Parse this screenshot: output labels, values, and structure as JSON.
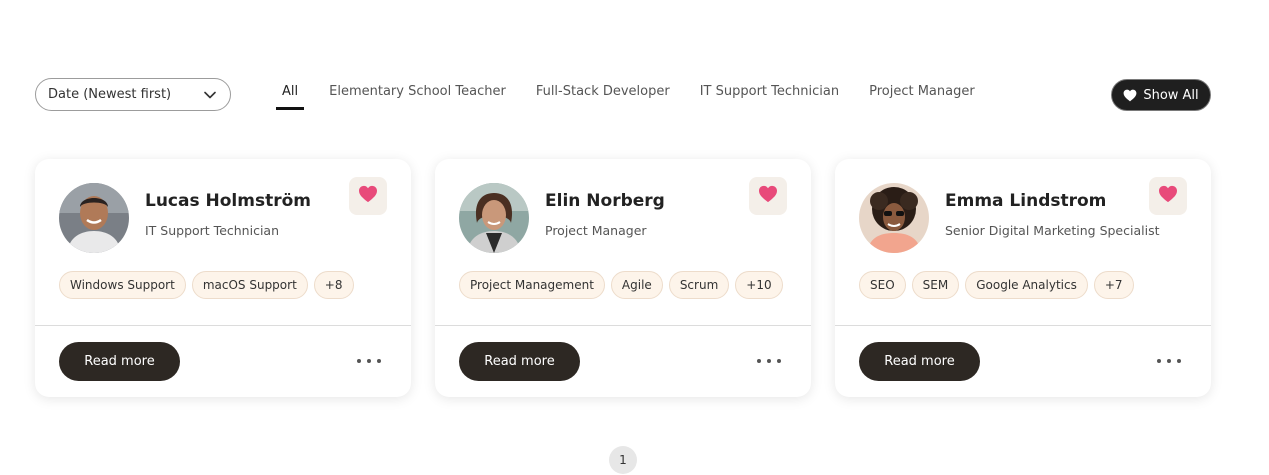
{
  "filters": {
    "sort_value": "Date (Newest first)",
    "tabs": [
      {
        "label": "All",
        "active": true
      },
      {
        "label": "Elementary School Teacher",
        "active": false
      },
      {
        "label": "Full-Stack Developer",
        "active": false
      },
      {
        "label": "IT Support Technician",
        "active": false
      },
      {
        "label": "Project Manager",
        "active": false
      }
    ],
    "show_all_label": "Show All"
  },
  "cards": [
    {
      "name": "Lucas Holmström",
      "role": "IT Support Technician",
      "tags": [
        "Windows Support",
        "macOS Support",
        "+8"
      ],
      "read_more": "Read more",
      "favorited": true
    },
    {
      "name": "Elin Norberg",
      "role": "Project Manager",
      "tags": [
        "Project Management",
        "Agile",
        "Scrum",
        "+10"
      ],
      "read_more": "Read more",
      "favorited": true
    },
    {
      "name": "Emma Lindstrom",
      "role": "Senior Digital Marketing Specialist",
      "tags": [
        "SEO",
        "SEM",
        "Google Analytics",
        "+7"
      ],
      "read_more": "Read more",
      "favorited": true
    }
  ],
  "pagination": {
    "current_page": "1"
  },
  "colors": {
    "heart": "#e84a7a",
    "dark_button": "#2d2823",
    "tag_bg": "#fdf4ea",
    "fav_bg": "#f4efe9"
  },
  "icons": {
    "sort_chevron": "chevron-down-icon",
    "show_all": "heart-icon",
    "favorite": "heart-icon",
    "card_menu": "more-horizontal-icon"
  }
}
